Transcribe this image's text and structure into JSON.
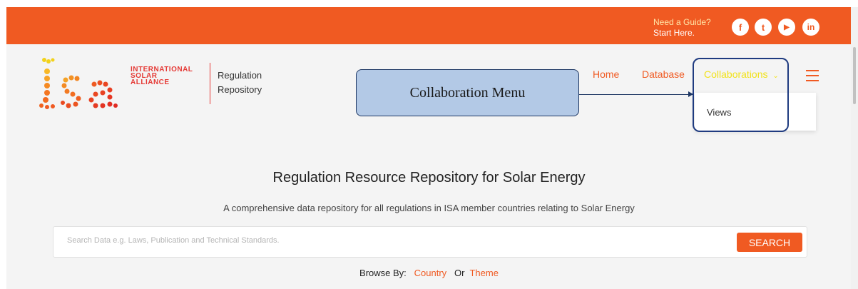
{
  "topbar": {
    "guide_line1": "Need a Guide?",
    "guide_line2": "Start Here.",
    "social": [
      {
        "icon": "facebook-icon",
        "glyph": "f"
      },
      {
        "icon": "twitter-icon",
        "glyph": "t"
      },
      {
        "icon": "youtube-icon",
        "glyph": "▶"
      },
      {
        "icon": "linkedin-icon",
        "glyph": "in"
      }
    ],
    "color": "#f05a22"
  },
  "logo": {
    "line1": "INTERNATIONAL",
    "line2": "SOLAR",
    "line3": "ALLIANCE",
    "site_line1": "Regulation",
    "site_line2": "Repository"
  },
  "annotation": {
    "callout": "Collaboration Menu"
  },
  "nav": {
    "items": [
      "Home",
      "Database",
      "Collaborations"
    ],
    "active": "Collaborations",
    "dropdown": [
      "Views"
    ]
  },
  "hero": {
    "title": "Regulation Resource Repository for Solar Energy",
    "subtitle": "A comprehensive data repository for all regulations in ISA member countries relating to Solar Energy"
  },
  "search": {
    "placeholder": "Search Data e.g. Laws, Publication and Technical Standards.",
    "button": "SEARCH"
  },
  "browse": {
    "label": "Browse By:",
    "opt1": "Country",
    "or": "Or",
    "opt2": "Theme"
  },
  "colors": {
    "accent": "#f05a22",
    "active_nav": "#f2e21b",
    "callout": "#b3c9e6",
    "outline": "#1f3b80"
  }
}
